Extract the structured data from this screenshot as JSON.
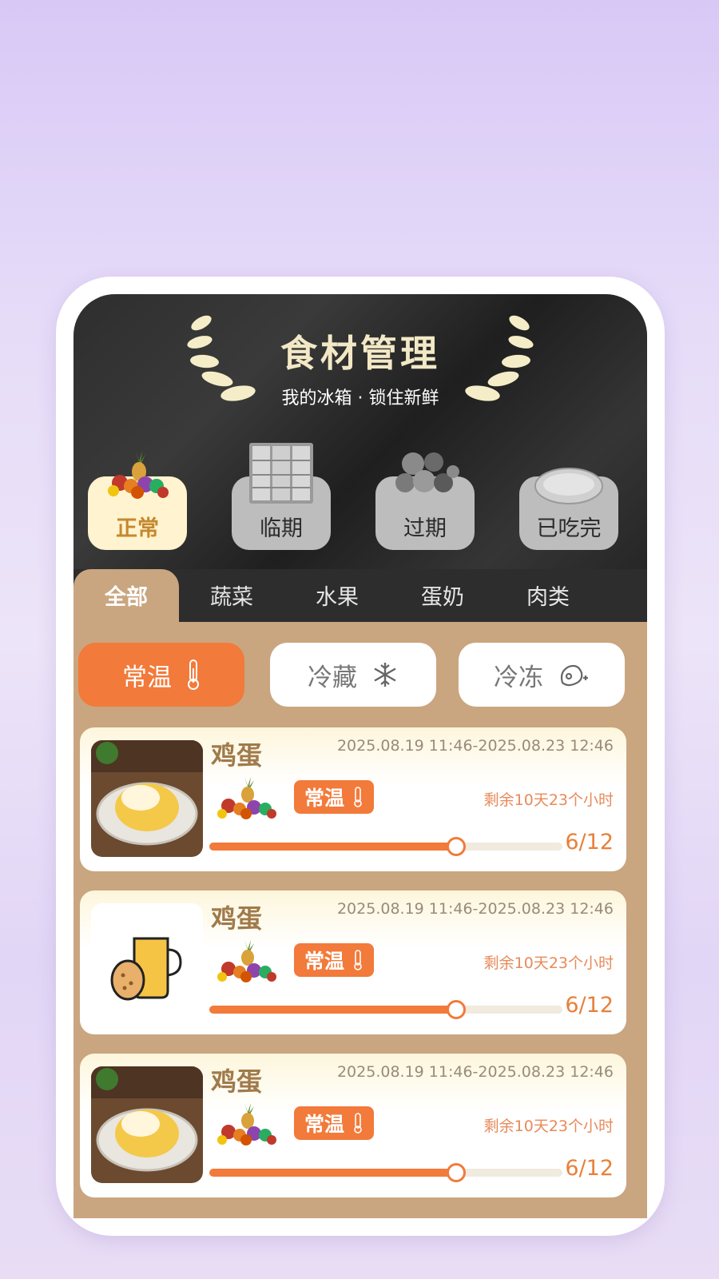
{
  "header": {
    "title": "食材管理",
    "subtitle": "我的冰箱 · 锁住新鲜"
  },
  "status_tabs": [
    {
      "label": "正常",
      "icon": "fruit-basket-icon",
      "active": true
    },
    {
      "label": "临期",
      "icon": "fridge-icon",
      "active": false
    },
    {
      "label": "过期",
      "icon": "vegetables-icon",
      "active": false
    },
    {
      "label": "已吃完",
      "icon": "empty-plate-icon",
      "active": false
    }
  ],
  "category_tabs": [
    {
      "label": "全部",
      "active": true
    },
    {
      "label": "蔬菜",
      "active": false
    },
    {
      "label": "水果",
      "active": false
    },
    {
      "label": "蛋奶",
      "active": false
    },
    {
      "label": "肉类",
      "active": false
    }
  ],
  "storage_filters": [
    {
      "label": "常温",
      "icon": "thermometer-icon",
      "active": true
    },
    {
      "label": "冷藏",
      "icon": "snowflake-icon",
      "active": false
    },
    {
      "label": "冷冻",
      "icon": "frozen-meat-icon",
      "active": false
    }
  ],
  "items": [
    {
      "name": "鸡蛋",
      "date_range": "2025.08.19 11:46-2025.08.23 12:46",
      "badge": "常温",
      "remaining": "剩余10天23个小时",
      "progress_text": "6/12",
      "progress": 0.7,
      "image": "omelette-photo"
    },
    {
      "name": "鸡蛋",
      "date_range": "2025.08.19 11:46-2025.08.23 12:46",
      "badge": "常温",
      "remaining": "剩余10天23个小时",
      "progress_text": "6/12",
      "progress": 0.7,
      "image": "milk-egg-icon"
    },
    {
      "name": "鸡蛋",
      "date_range": "2025.08.19 11:46-2025.08.23 12:46",
      "badge": "常温",
      "remaining": "剩余10天23个小时",
      "progress_text": "6/12",
      "progress": 0.7,
      "image": "omelette-photo"
    }
  ],
  "colors": {
    "accent": "#f27a3a",
    "tan": "#c9a680",
    "dark_header": "#2e2e2e",
    "title_gold": "#f3e8c6"
  }
}
